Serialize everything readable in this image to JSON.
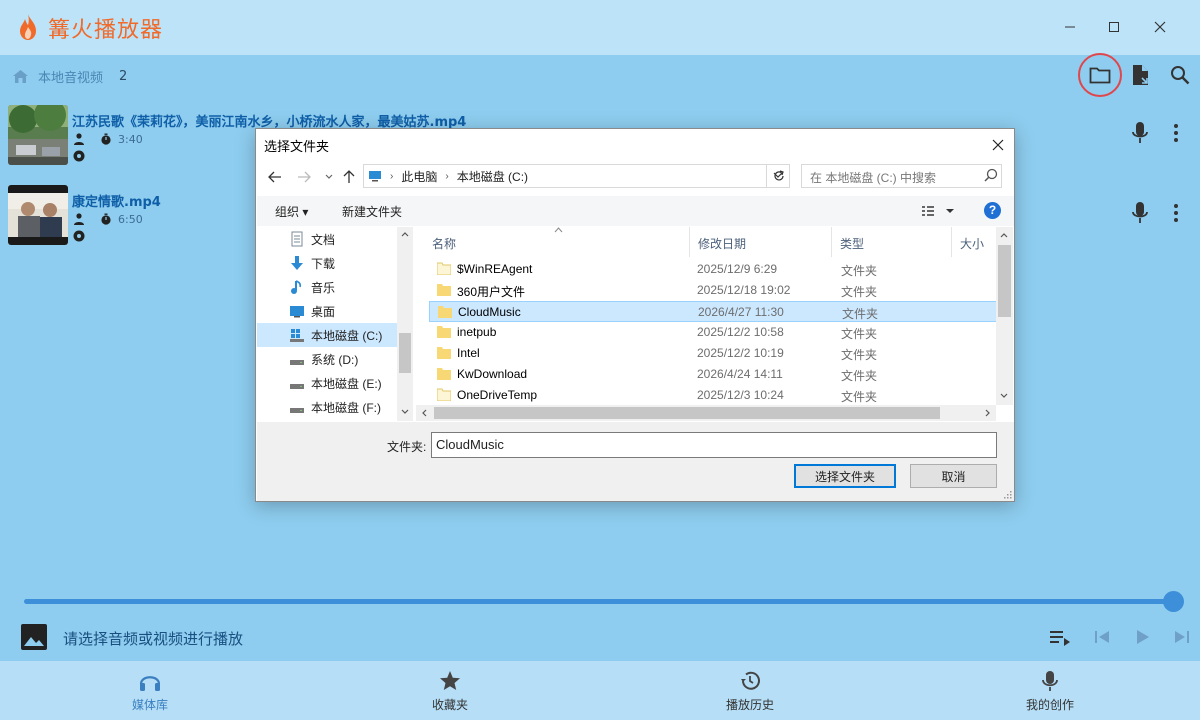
{
  "app": {
    "title": "篝火播放器",
    "logo_icon": "flame-icon",
    "accent_color": "#3c8fd8",
    "title_color": "#f06a2a"
  },
  "header": {
    "crumb_label": "本地音视频",
    "crumb_count": "2"
  },
  "media_list": [
    {
      "title": "江苏民歌《茉莉花》，美丽江南水乡，小桥流水人家，最美姑苏.mp4",
      "duration": "3:40"
    },
    {
      "title": "康定情歌.mp4",
      "duration": "6:50"
    }
  ],
  "player": {
    "now_playing_text": "请选择音频或视频进行播放",
    "progress": 1.0
  },
  "bottom_nav": [
    {
      "label": "媒体库",
      "icon": "headphones-icon",
      "active": true
    },
    {
      "label": "收藏夹",
      "icon": "star-icon",
      "active": false
    },
    {
      "label": "播放历史",
      "icon": "history-icon",
      "active": false
    },
    {
      "label": "我的创作",
      "icon": "mic-icon",
      "active": false
    }
  ],
  "dialog": {
    "title": "选择文件夹",
    "breadcrumb": [
      "此电脑",
      "本地磁盘 (C:)"
    ],
    "search_placeholder": "在 本地磁盘 (C:) 中搜索",
    "organize_label": "组织 ▾",
    "new_folder_label": "新建文件夹",
    "help_label": "?",
    "tree": [
      {
        "label": "文档",
        "icon": "documents-icon",
        "selected": false
      },
      {
        "label": "下载",
        "icon": "download-icon",
        "selected": false
      },
      {
        "label": "音乐",
        "icon": "music-icon",
        "selected": false
      },
      {
        "label": "桌面",
        "icon": "desktop-icon",
        "selected": false
      },
      {
        "label": "本地磁盘 (C:)",
        "icon": "windows-drive-icon",
        "selected": true
      },
      {
        "label": "系统 (D:)",
        "icon": "drive-icon",
        "selected": false
      },
      {
        "label": "本地磁盘 (E:)",
        "icon": "drive-icon",
        "selected": false
      },
      {
        "label": "本地磁盘 (F:)",
        "icon": "drive-icon",
        "selected": false
      }
    ],
    "columns": [
      "名称",
      "修改日期",
      "类型",
      "大小"
    ],
    "rows": [
      {
        "name": "$WinREAgent",
        "date": "2025/12/9 6:29",
        "type": "文件夹",
        "selected": false
      },
      {
        "name": "360用户文件",
        "date": "2025/12/18 19:02",
        "type": "文件夹",
        "selected": false
      },
      {
        "name": "CloudMusic",
        "date": "2026/4/27 11:30",
        "type": "文件夹",
        "selected": true
      },
      {
        "name": "inetpub",
        "date": "2025/12/2 10:58",
        "type": "文件夹",
        "selected": false
      },
      {
        "name": "Intel",
        "date": "2025/12/2 10:19",
        "type": "文件夹",
        "selected": false
      },
      {
        "name": "KwDownload",
        "date": "2026/4/24 14:11",
        "type": "文件夹",
        "selected": false
      },
      {
        "name": "OneDriveTemp",
        "date": "2025/12/3 10:24",
        "type": "文件夹",
        "selected": false
      }
    ],
    "folder_label": "文件夹:",
    "folder_value": "CloudMusic",
    "ok_label": "选择文件夹",
    "cancel_label": "取消"
  }
}
